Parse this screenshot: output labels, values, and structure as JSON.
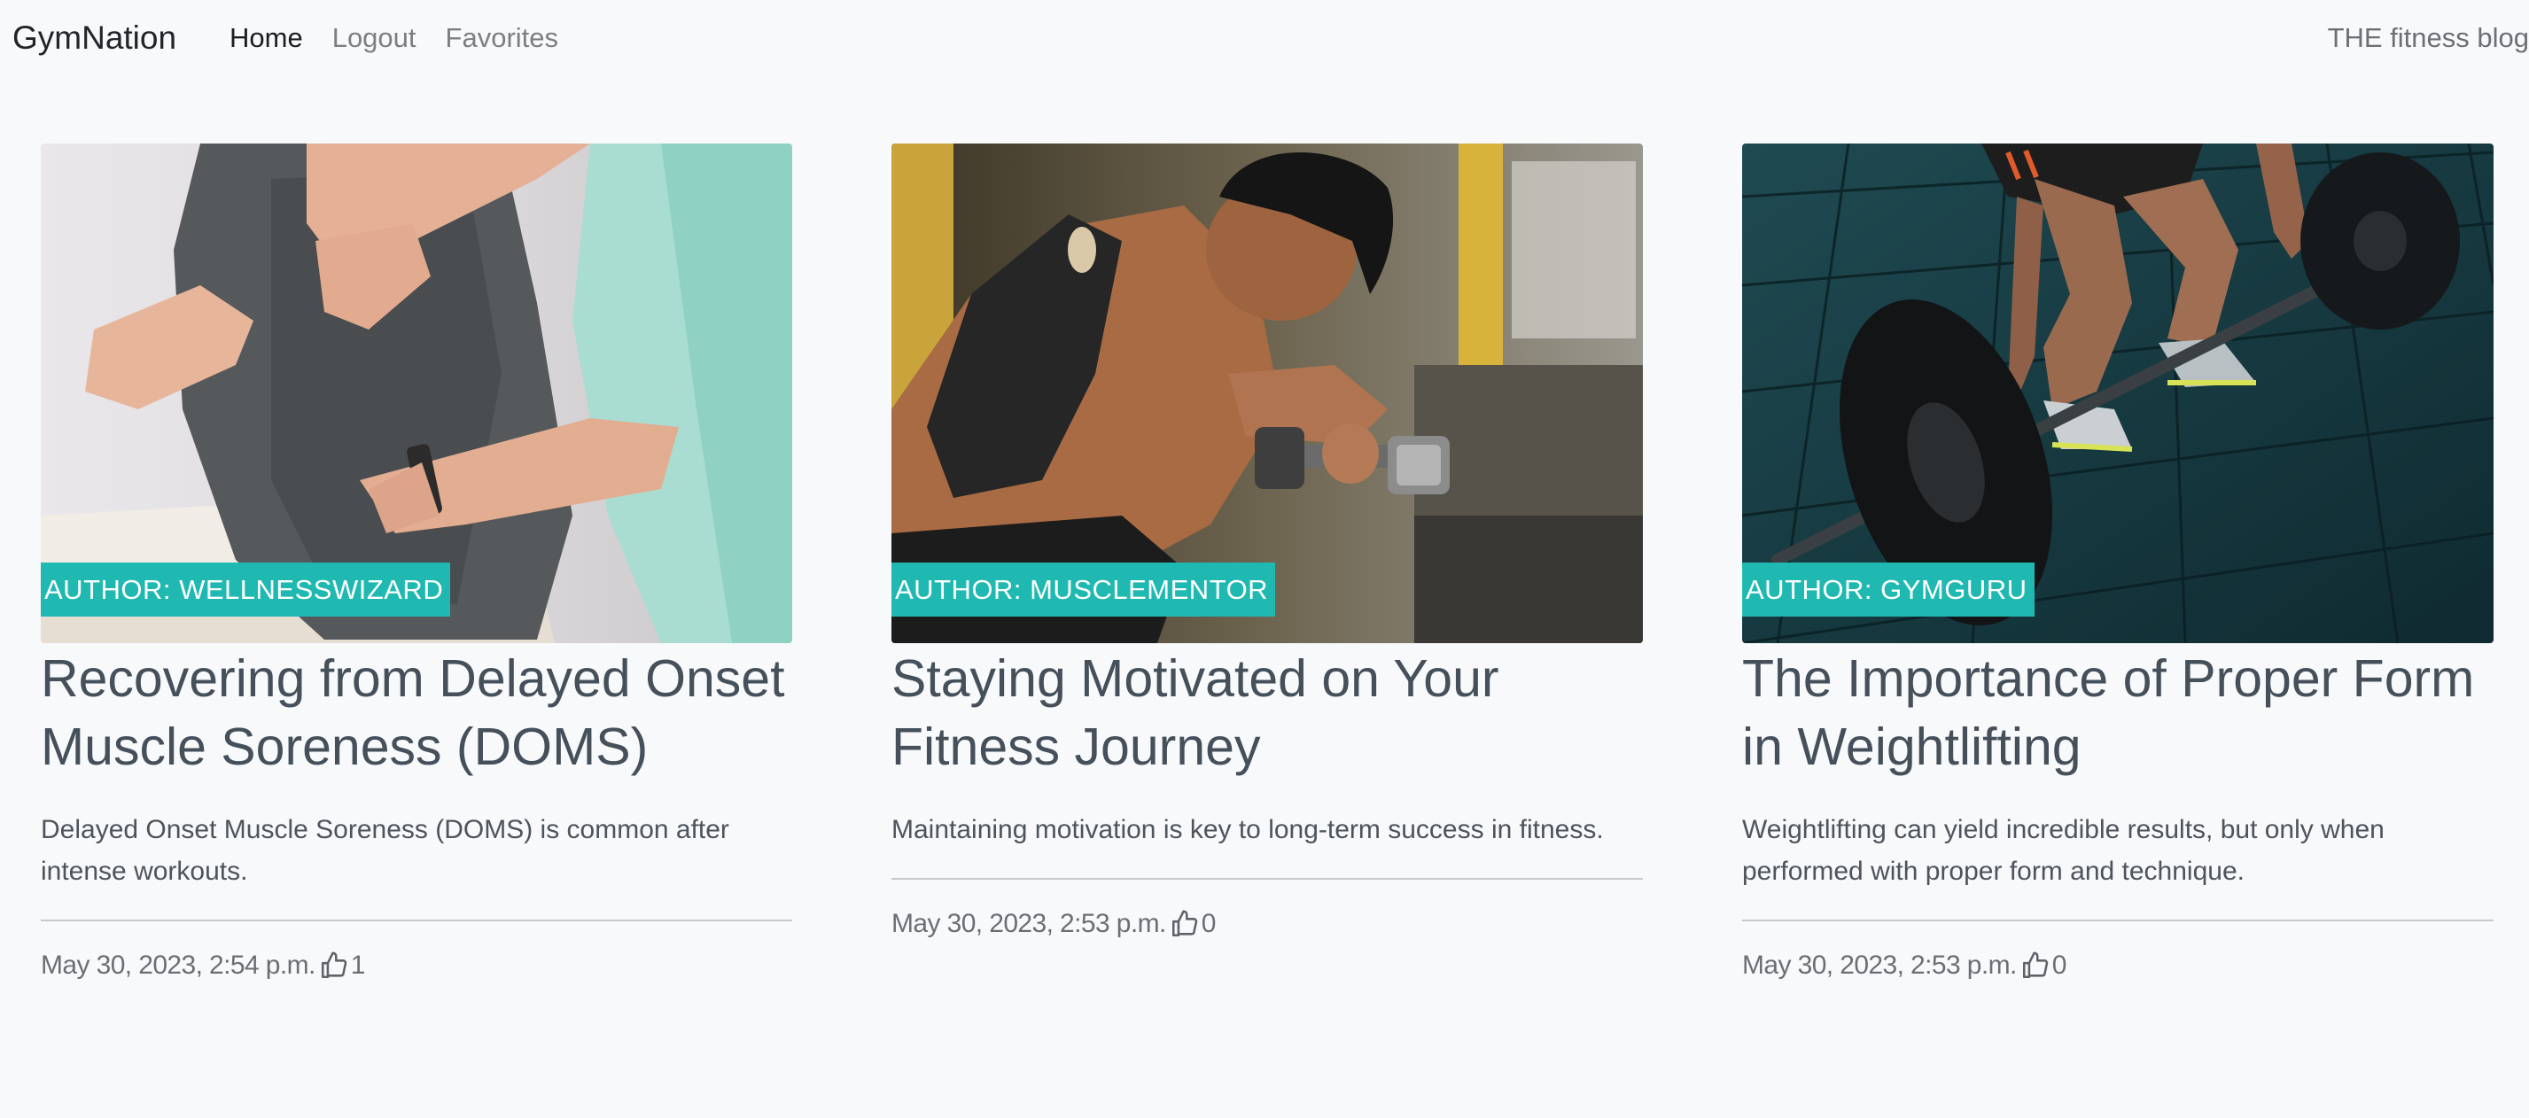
{
  "nav": {
    "brand": "GymNation",
    "links": [
      "Home",
      "Logout",
      "Favorites"
    ],
    "tagline": "THE fitness blog"
  },
  "posts": [
    {
      "author_badge": "AUTHOR: WELLNESSWIZARD",
      "title": "Recovering from Delayed Onset Muscle Soreness (DOMS)",
      "excerpt": "Delayed Onset Muscle Soreness (DOMS) is common after intense workouts.",
      "date": "May 30, 2023, 2:54 p.m.",
      "likes": "1",
      "image": "physiotherapist-back-massage"
    },
    {
      "author_badge": "AUTHOR: MUSCLEMENTOR",
      "title": "Staying Motivated on Your Fitness Journey",
      "excerpt": "Maintaining motivation is key to long-term success in fitness.",
      "date": "May 30, 2023, 2:53 p.m.",
      "likes": "0",
      "image": "man-dumbbell-curl-gym"
    },
    {
      "author_badge": "AUTHOR: GYMGURU",
      "title": "The Importance of Proper Form in Weightlifting",
      "excerpt": "Weightlifting can yield incredible results, but only when performed with proper form and technique.",
      "date": "May 30, 2023, 2:53 p.m.",
      "likes": "0",
      "image": "barbell-deadlift-floor"
    }
  ],
  "icons": {
    "like": "thumbs-up-icon"
  },
  "colors": {
    "accent": "#20b9b1",
    "title": "#45505b",
    "background": "#f8f9fb"
  }
}
